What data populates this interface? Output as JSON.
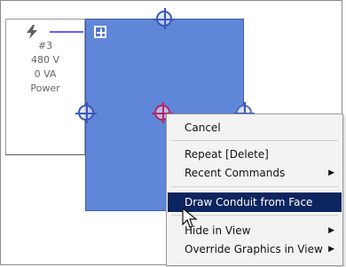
{
  "panel": {
    "icon": "lightning-icon",
    "lines": [
      "#3",
      "480 V",
      "0 VA",
      "Power"
    ]
  },
  "menu": {
    "items": [
      {
        "label": "Cancel"
      },
      {
        "label": "Repeat [Delete]"
      },
      {
        "label": "Recent Commands",
        "submenu": true
      },
      {
        "label": "Draw Conduit from Face",
        "highlighted": true
      },
      {
        "label": "Hide in View",
        "submenu": true
      },
      {
        "label": "Override Graphics in View",
        "submenu": true
      }
    ]
  },
  "colors": {
    "selection_fill": "#5f86d8",
    "selection_border": "#3b5caa",
    "connector_blue": "#5f63ff",
    "menu_highlight": "#0d255f"
  },
  "icons": {
    "selector": "move-selector-icon",
    "top_handle": "connector-handle-icon",
    "left_handle": "connector-handle-icon",
    "middle_handle": "connector-handle-icon",
    "right_handle": "connector-handle-icon",
    "cursor": "mouse-pointer-icon",
    "submenu_arrow": "submenu-arrow-icon"
  }
}
